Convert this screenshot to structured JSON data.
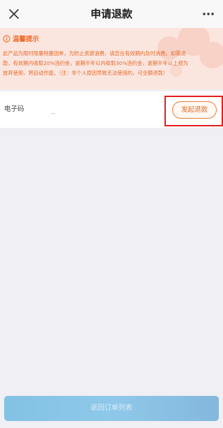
{
  "header": {
    "title": "申请退款",
    "close_icon": "close-icon",
    "more_icon": "more-dots-icon"
  },
  "notice": {
    "icon": "info-icon",
    "title": "温馨提示",
    "lines": [
      "此产品为限时限量特惠团单，为防止资源浪费，请您在有效期内及时消费。如需退",
      "款，有效期内收取20%违约金，逾期半年以内收取30%违约金，逾期半年以上视为",
      "放弃使用，将自动作废。（注：非个人原因导致无法使用的，可全额退款）"
    ]
  },
  "code_row": {
    "label": "电子码",
    "value": "_",
    "button_label": "发起退款"
  },
  "footer": {
    "button_label": "返回订单列表"
  },
  "colors": {
    "accent": "#ef6b2a",
    "notice_bg": "#fbe6df",
    "highlight": "#e51c1c",
    "footer_button": "#2a9dd7"
  }
}
